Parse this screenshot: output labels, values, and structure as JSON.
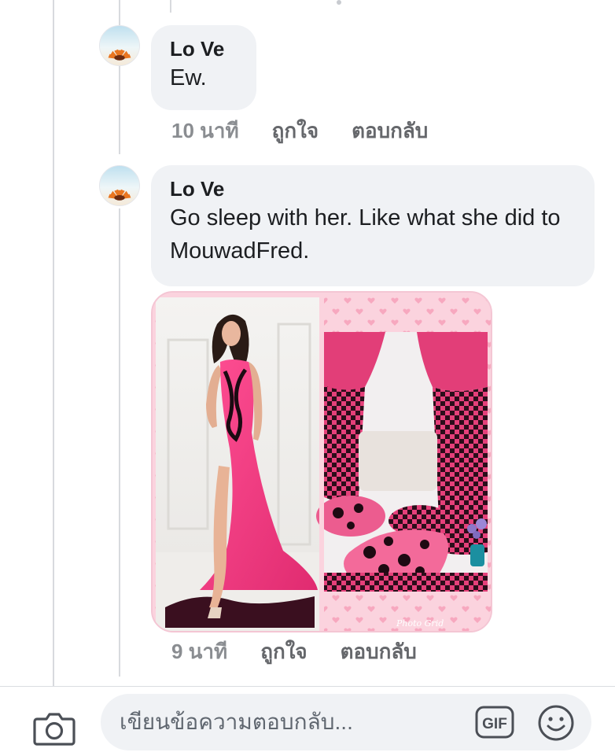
{
  "thread": {
    "comments": [
      {
        "author": "Lo Ve",
        "text": "Ew.",
        "time": "10 นาที",
        "like_label": "ถูกใจ",
        "reply_label": "ตอบกลับ"
      },
      {
        "author": "Lo Ve",
        "text": "Go sleep with her. Like what she did to MouwadFred.",
        "time": "9 นาที",
        "like_label": "ถูกใจ",
        "reply_label": "ตอบกลับ",
        "attachment": {
          "type": "image",
          "left_panel": "woman-in-pink-gown",
          "right_panel": "pink-polka-dot-canopy-bed",
          "watermark": "Photo Grid"
        }
      }
    ]
  },
  "composer": {
    "placeholder": "เขียนข้อความตอบกลับ...",
    "gif_label": "GIF",
    "icons": [
      "camera-icon",
      "gif-icon",
      "emoji-icon"
    ]
  },
  "colors": {
    "bubble": "#f0f2f5",
    "meta_text": "#65676b",
    "accent_pink": "#ee4f8b",
    "thread_line": "#d8dade"
  }
}
